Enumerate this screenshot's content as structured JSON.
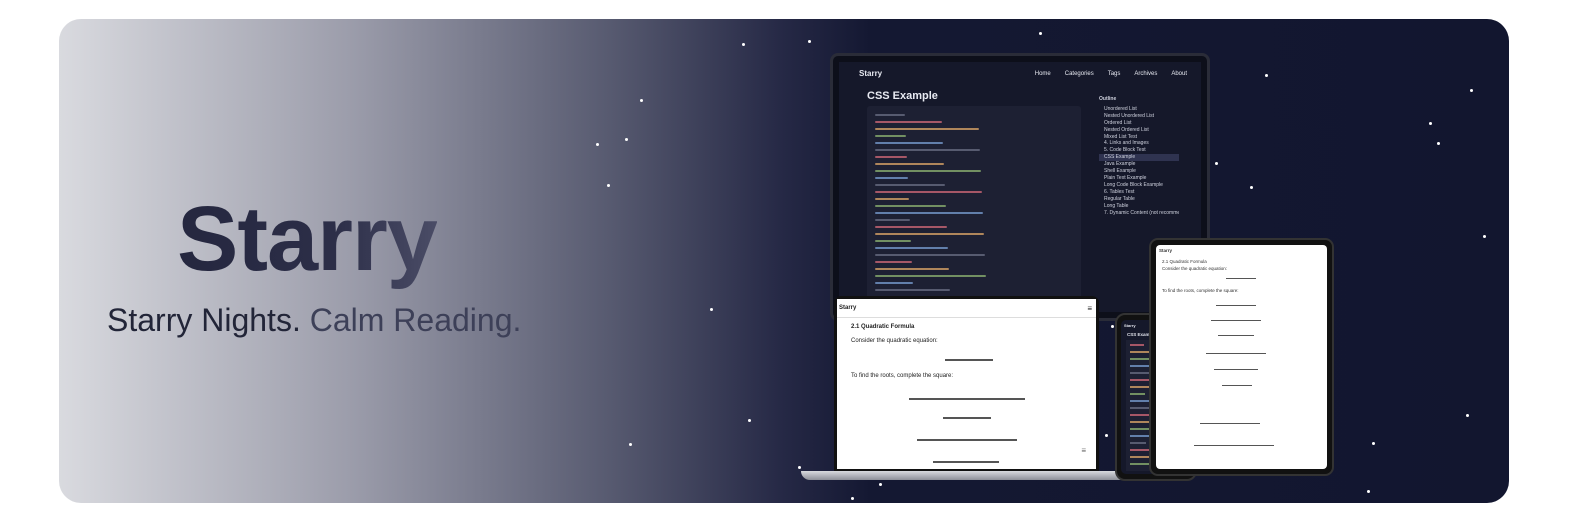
{
  "hero": {
    "title": "Starry",
    "tagline_part1": "Starry Nights.",
    "tagline_part2": "Calm Reading."
  },
  "desktop": {
    "brand": "Starry",
    "nav": [
      "Home",
      "Categories",
      "Tags",
      "Archives",
      "About"
    ],
    "page_title": "CSS Example",
    "outline_heading": "Outline",
    "outline_items": [
      "Unordered List",
      "Nested Unordered List",
      "Ordered List",
      "Nested Ordered List",
      "Mixed List Test",
      "4. Links and Images",
      "5. Code Block Test",
      "CSS Example",
      "Java Example",
      "Shell Example",
      "Plain Text Example",
      "Long Code Block Example",
      "6. Tables Test",
      "Regular Table",
      "Long Table",
      "7. Dynamic Content (not recommended directly in"
    ],
    "outline_active_index": 7
  },
  "laptop": {
    "brand": "Starry",
    "section": "2.1 Quadratic Formula",
    "intro": "Consider the quadratic equation:",
    "step": "To find the roots, complete the square:"
  },
  "phone": {
    "brand": "Starry",
    "page_title": "CSS Example"
  },
  "tablet": {
    "brand": "Starry",
    "section": "2.1 Quadratic Formula",
    "intro": "Consider the quadratic equation:",
    "step": "To find the roots, complete the square:"
  },
  "colors": {
    "night": "#12162f",
    "light": "#d9dadf",
    "star": "#ffffff"
  }
}
